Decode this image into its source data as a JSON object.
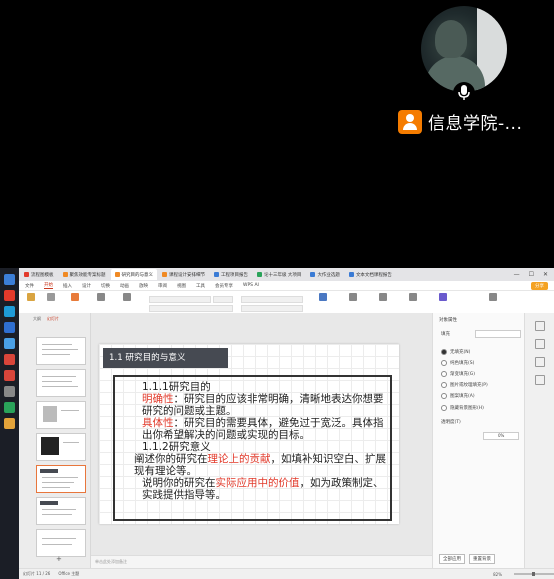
{
  "participant": {
    "name": "信息学院-..."
  },
  "app": {
    "tabs": [
      "流程图模板",
      "聚焦效能专案标题",
      "研究目的与意义",
      "课程设计安排细节",
      "工程项目报告",
      "论十三年级 大项目",
      "大作业选题",
      "文本文档课程报告"
    ],
    "active_tab": 2,
    "menu": [
      "文件",
      "开始",
      "插入",
      "设计",
      "切换",
      "动画",
      "放映",
      "审阅",
      "视图",
      "工具",
      "会员专享",
      "WPS AI"
    ],
    "active_menu": "开始",
    "share_label": "分享"
  },
  "thumbs_header": {
    "outline": "大纲",
    "slides": "幻灯片"
  },
  "slide": {
    "title": "1.1  研究目的与意义",
    "heading1": "1.1.1研究目的",
    "p1_label": "明确性",
    "p1_text": "：研究目的应该非常明确，清晰地表达你想要研究的问题或主题。",
    "p2_label": "具体性",
    "p2_text": "：研究目的需要具体，避免过于宽泛。具体指出你希望解决的问题或实现的目标。",
    "heading2": "1.1.2研究意义",
    "p3_pre": "阐述你的研究在",
    "p3_highlight": "理论上的贡献",
    "p3_post": "，如填补知识空白、扩展现有理论等。",
    "p4_pre": "说明你的研究在",
    "p4_highlight": "实际应用中的价值",
    "p4_post": "，如为政策制定、实践提供指导等。"
  },
  "notes_placeholder": "单击此处添加备注",
  "pane": {
    "title": "对象属性",
    "section": "填充",
    "options": [
      "无填充(N)",
      "纯色填充(S)",
      "渐变填充(G)",
      "图片或纹理填充(P)",
      "图案填充(A)",
      "隐藏背景图形(H)"
    ],
    "transparency_label": "透明度(T)",
    "transparency_value": "0%",
    "apply_all": "全部应用",
    "reset_bg": "重置背景"
  },
  "status": {
    "slide_info": "幻灯片 11 / 26",
    "theme": "Office 主题",
    "zoom": "82%"
  },
  "colors": {
    "accent": "#c8381f",
    "highlight_text": "#e23a2b",
    "title_bar": "#464a52"
  }
}
